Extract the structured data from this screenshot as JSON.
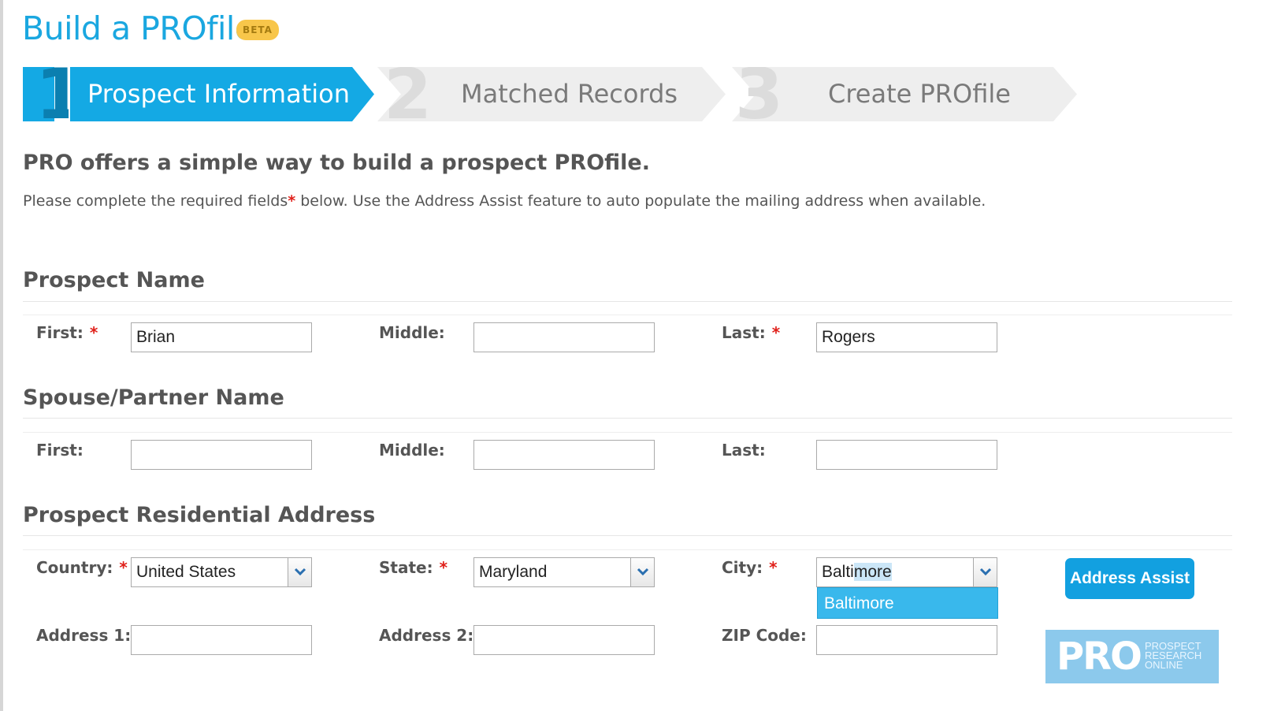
{
  "header": {
    "title": "Build a PROfile",
    "badge": "BETA"
  },
  "steps": [
    {
      "number": "1",
      "label": "Prospect Information",
      "state": "active"
    },
    {
      "number": "2",
      "label": "Matched Records",
      "state": "inactive"
    },
    {
      "number": "3",
      "label": "Create PROfile",
      "state": "inactive"
    }
  ],
  "intro": {
    "heading": "PRO offers a simple way to build a prospect PROfile.",
    "text_before": "Please complete the required fields",
    "required_marker": "*",
    "text_after": " below. Use the Address Assist feature to auto populate the mailing address when available."
  },
  "prospect_name": {
    "heading": "Prospect Name",
    "first_label": "First:",
    "first_value": "Brian",
    "middle_label": "Middle:",
    "middle_value": "",
    "last_label": "Last:",
    "last_value": "Rogers"
  },
  "spouse_name": {
    "heading": "Spouse/Partner Name",
    "first_label": "First:",
    "first_value": "",
    "middle_label": "Middle:",
    "middle_value": "",
    "last_label": "Last:",
    "last_value": ""
  },
  "address": {
    "heading": "Prospect Residential Address",
    "country_label": "Country:",
    "country_value": "United States",
    "state_label": "State:",
    "state_value": "Maryland",
    "city_label": "City:",
    "city_typed": "Balti",
    "city_autocomplete": "more",
    "city_suggestion": "Baltimore",
    "address1_label": "Address 1:",
    "address1_value": "",
    "address2_label": "Address 2:",
    "address2_value": "",
    "zip_label": "ZIP Code:",
    "zip_value": "",
    "assist_button": "Address Assist"
  },
  "required_marker": "*",
  "logo": {
    "mark": "PRO",
    "line1": "PROSPECT",
    "line2": "RESEARCH",
    "line3": "ONLINE"
  },
  "colors": {
    "accent": "#1aa7e0",
    "badge": "#f8c64a",
    "required": "#e0201a",
    "step_inactive": "#eeeeee"
  }
}
